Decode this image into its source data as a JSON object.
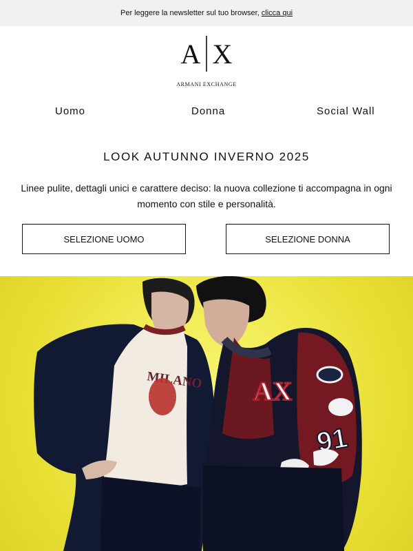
{
  "top_bar": {
    "text": "Per leggere la newsletter sul tuo browser,",
    "link": "clicca qui"
  },
  "brand": {
    "logo_mark_left": "A",
    "logo_mark_right": "X",
    "name": "ARMANI EXCHANGE"
  },
  "nav": {
    "items": [
      "Uomo",
      "Donna",
      "Social Wall"
    ]
  },
  "content": {
    "headline": "LOOK AUTUNNO INVERNO 2025",
    "description": "Linee pulite, dettagli unici e carattere deciso: la nuova collezione ti accompagna in ogni momento con stile e personalità."
  },
  "cta": {
    "men_label": "SELEZIONE UOMO",
    "women_label": "SELEZIONE DONNA"
  },
  "hero": {
    "image_name": "ax-fall-winter-2025-models",
    "background_color": "#f2ec55",
    "shirt_print": "MILANO",
    "jacket_logo": "AX",
    "sleeve_number": "91"
  }
}
